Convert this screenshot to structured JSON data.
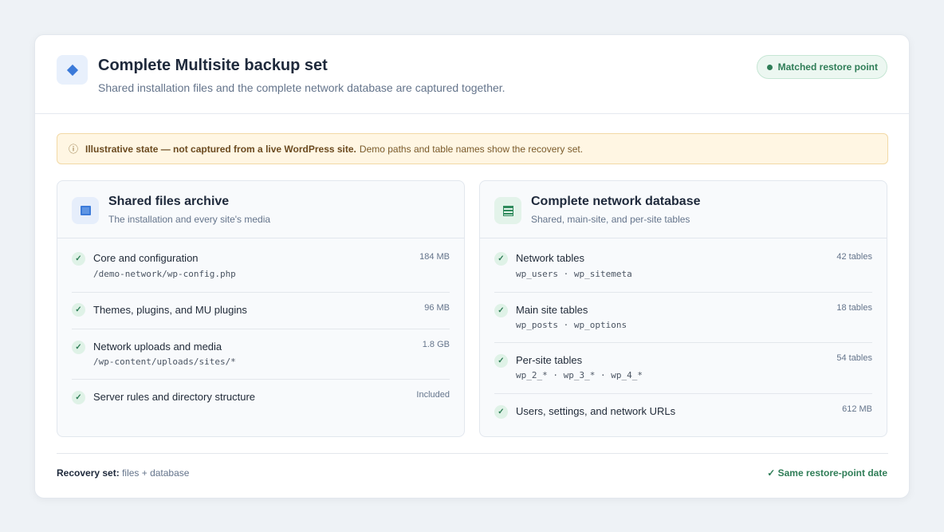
{
  "header": {
    "title": "Complete Multisite backup set",
    "subtitle": "Shared installation files and the complete network database are captured together.",
    "status_badge": "Matched restore point"
  },
  "notice": {
    "icon": "info-icon",
    "strong": "Illustrative state — not captured from a live WordPress site.",
    "text": "Demo paths and table names show the recovery set."
  },
  "files_panel": {
    "icon": "archive-icon",
    "title": "Shared files archive",
    "subtitle": "The installation and every site's media",
    "items": [
      {
        "label": "Core and configuration",
        "detail": "/demo-network/wp-config.php",
        "size": "184 MB"
      },
      {
        "label": "Themes, plugins, and MU plugins",
        "detail": "",
        "size": "96 MB"
      },
      {
        "label": "Network uploads and media",
        "detail": "/wp-content/uploads/sites/*",
        "size": "1.8 GB"
      },
      {
        "label": "Server rules and directory structure",
        "detail": "",
        "size": "Included"
      }
    ]
  },
  "database_panel": {
    "icon": "database-icon",
    "title": "Complete network database",
    "subtitle": "Shared, main-site, and per-site tables",
    "items": [
      {
        "label": "Network tables",
        "detail": "wp_users · wp_sitemeta",
        "size": "42 tables"
      },
      {
        "label": "Main site tables",
        "detail": "wp_posts · wp_options",
        "size": "18 tables"
      },
      {
        "label": "Per-site tables",
        "detail": "wp_2_* · wp_3_* · wp_4_*",
        "size": "54 tables"
      },
      {
        "label": "Users, settings, and network URLs",
        "detail": "",
        "size": "612 MB"
      }
    ]
  },
  "footer": {
    "recovery_label": "Recovery set:",
    "recovery_value": "files + database",
    "status": "✓ Same restore-point date"
  },
  "check_glyph": "✓",
  "colors": {
    "accent_blue": "#3b7ad9",
    "success_green": "#2f7d57",
    "warning_bg": "#fff6e3"
  }
}
